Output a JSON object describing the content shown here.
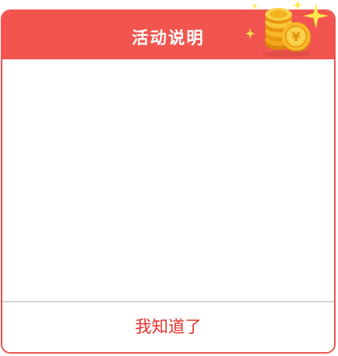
{
  "dialog": {
    "title": "活动说明",
    "confirm_label": "我知道了",
    "content_text": ""
  },
  "decoration": {
    "coins_icon": "gold-coins-icon",
    "sparkle_icon": "sparkle-icon"
  },
  "colors": {
    "header_red": "#f2554f",
    "button_text_red": "#e6322c",
    "coin_gold": "#f6b51a",
    "sparkle_yellow": "#fde84c"
  }
}
